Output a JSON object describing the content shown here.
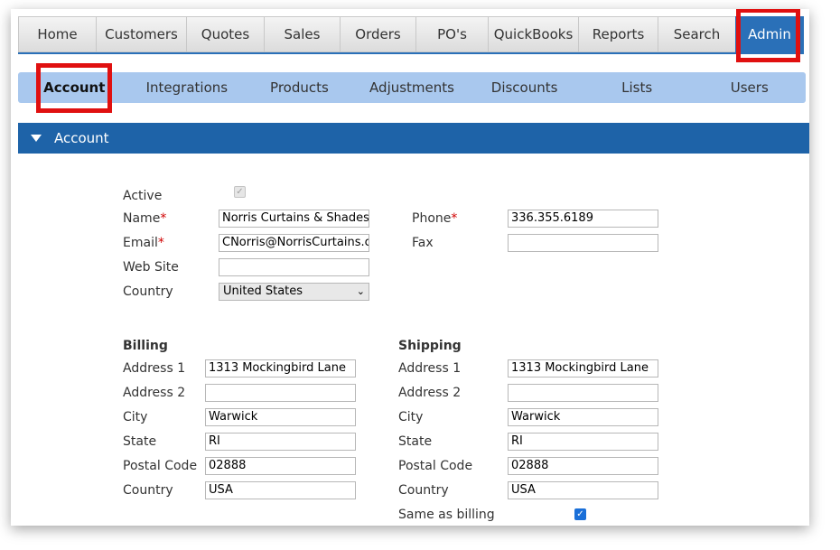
{
  "topnav": {
    "tabs": [
      "Home",
      "Customers",
      "Quotes",
      "Sales",
      "Orders",
      "PO's",
      "QuickBooks",
      "Reports",
      "Search",
      "Admin"
    ],
    "active": "Admin"
  },
  "subnav": {
    "tabs": [
      "Account",
      "Integrations",
      "Products",
      "Adjustments",
      "Discounts",
      "Lists",
      "Users"
    ],
    "active": "Account"
  },
  "section": {
    "title": "Account"
  },
  "account": {
    "active_label": "Active",
    "active_checked": true,
    "name_label": "Name",
    "name_value": "Norris Curtains & Shades",
    "email_label": "Email",
    "email_value": "CNorris@NorrisCurtains.com",
    "website_label": "Web Site",
    "website_value": "",
    "country_label": "Country",
    "country_value": "United States",
    "phone_label": "Phone",
    "phone_value": "336.355.6189",
    "fax_label": "Fax",
    "fax_value": "",
    "required_mark": "*"
  },
  "billing": {
    "heading": "Billing",
    "address1_label": "Address 1",
    "address1": "1313 Mockingbird Lane",
    "address2_label": "Address 2",
    "address2": "",
    "city_label": "City",
    "city": "Warwick",
    "state_label": "State",
    "state": "RI",
    "postal_label": "Postal Code",
    "postal": "02888",
    "country_label": "Country",
    "country": "USA"
  },
  "shipping": {
    "heading": "Shipping",
    "address1_label": "Address 1",
    "address1": "1313 Mockingbird Lane",
    "address2_label": "Address 2",
    "address2": "",
    "city_label": "City",
    "city": "Warwick",
    "state_label": "State",
    "state": "RI",
    "postal_label": "Postal Code",
    "postal": "02888",
    "country_label": "Country",
    "country": "USA",
    "same_label": "Same as billing",
    "same_checked": true
  },
  "colors": {
    "accent": "#1e63a8",
    "subnav": "#a9c8ee",
    "highlight": "#e01010"
  }
}
